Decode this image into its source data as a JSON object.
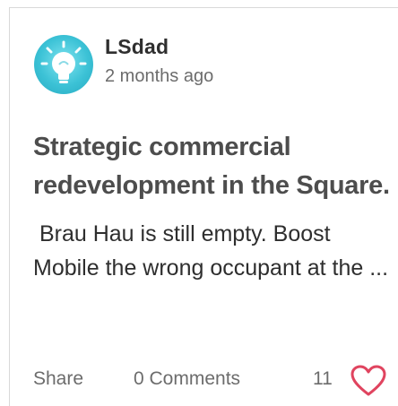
{
  "post": {
    "author": "LSdad",
    "timestamp": "2 months ago",
    "title": "Strategic commercial redevelopment in the Square.",
    "excerpt": " Brau Hau is still empty. Boost Mobile the wrong occupant at the ...",
    "avatar_icon": "lightbulb-avatar-icon"
  },
  "footer": {
    "share_label": "Share",
    "comments_label": "0 Comments",
    "likes_count": "11",
    "like_icon": "heart-icon"
  },
  "colors": {
    "avatar_teal": "#3cc2d6",
    "heart_red": "#e0445f",
    "title_gray": "#4d4d4d"
  }
}
